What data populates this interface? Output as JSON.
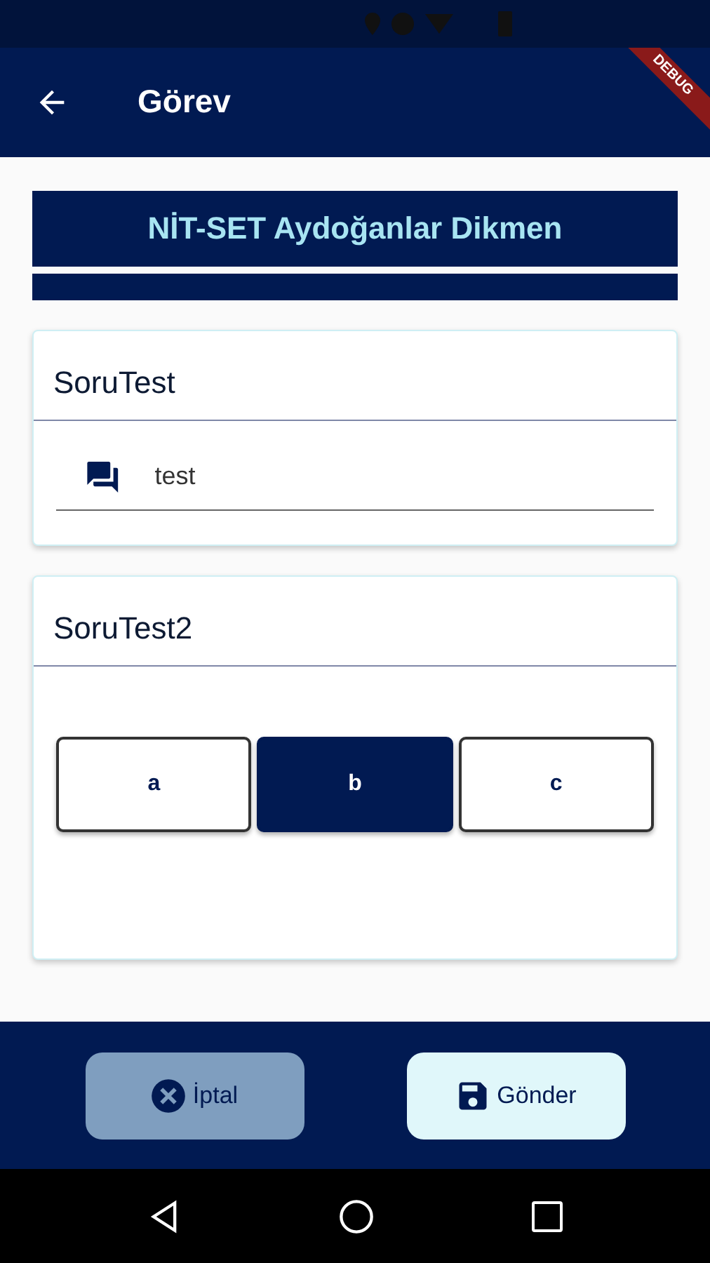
{
  "app_bar": {
    "title": "Görev"
  },
  "debug_banner": "DEBUG",
  "header": {
    "title": "NİT-SET Aydoğanlar Dikmen"
  },
  "questions": [
    {
      "kind": "text",
      "title": "SoruTest",
      "value": "test"
    },
    {
      "kind": "choice",
      "title": "SoruTest2",
      "options": [
        {
          "label": "a",
          "selected": false
        },
        {
          "label": "b",
          "selected": true
        },
        {
          "label": "c",
          "selected": false
        }
      ]
    }
  ],
  "buttons": [
    {
      "kind": "cancel",
      "label": "İptal"
    },
    {
      "kind": "send",
      "label": "Gönder"
    }
  ]
}
